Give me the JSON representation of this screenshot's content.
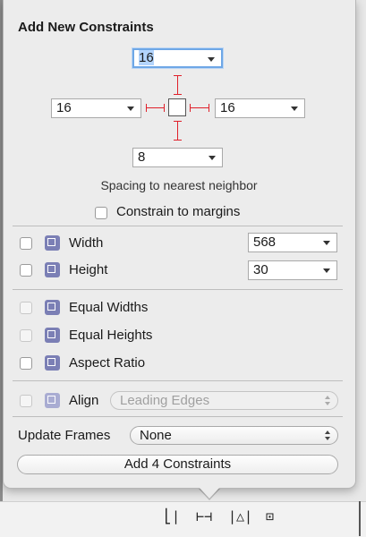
{
  "panel": {
    "title": "Add New Constraints",
    "spacing": {
      "top": "16",
      "left": "16",
      "right": "16",
      "bottom": "8",
      "caption": "Spacing to nearest neighbor"
    },
    "constrain_to_margins": {
      "label": "Constrain to margins",
      "checked": false
    },
    "width": {
      "label": "Width",
      "value": "568",
      "checked": false
    },
    "height": {
      "label": "Height",
      "value": "30",
      "checked": false
    },
    "equal_widths": {
      "label": "Equal Widths",
      "enabled": false
    },
    "equal_heights": {
      "label": "Equal Heights",
      "enabled": false
    },
    "aspect_ratio": {
      "label": "Aspect Ratio",
      "checked": false
    },
    "align": {
      "label": "Align",
      "value": "Leading Edges",
      "enabled": false
    },
    "update_frames": {
      "label": "Update Frames",
      "value": "None"
    },
    "add_button": "Add 4 Constraints"
  },
  "toolbar": {
    "icons": [
      "align-icon",
      "pin-icon",
      "resolve-icon",
      "resizing-icon"
    ],
    "glyphs": [
      "⎣|",
      "⊢⊣",
      "|△|",
      "⊡"
    ]
  },
  "colors": {
    "strut": "#e0202a",
    "focus": "#6ea7e6",
    "icon": "#7b7fb5"
  }
}
